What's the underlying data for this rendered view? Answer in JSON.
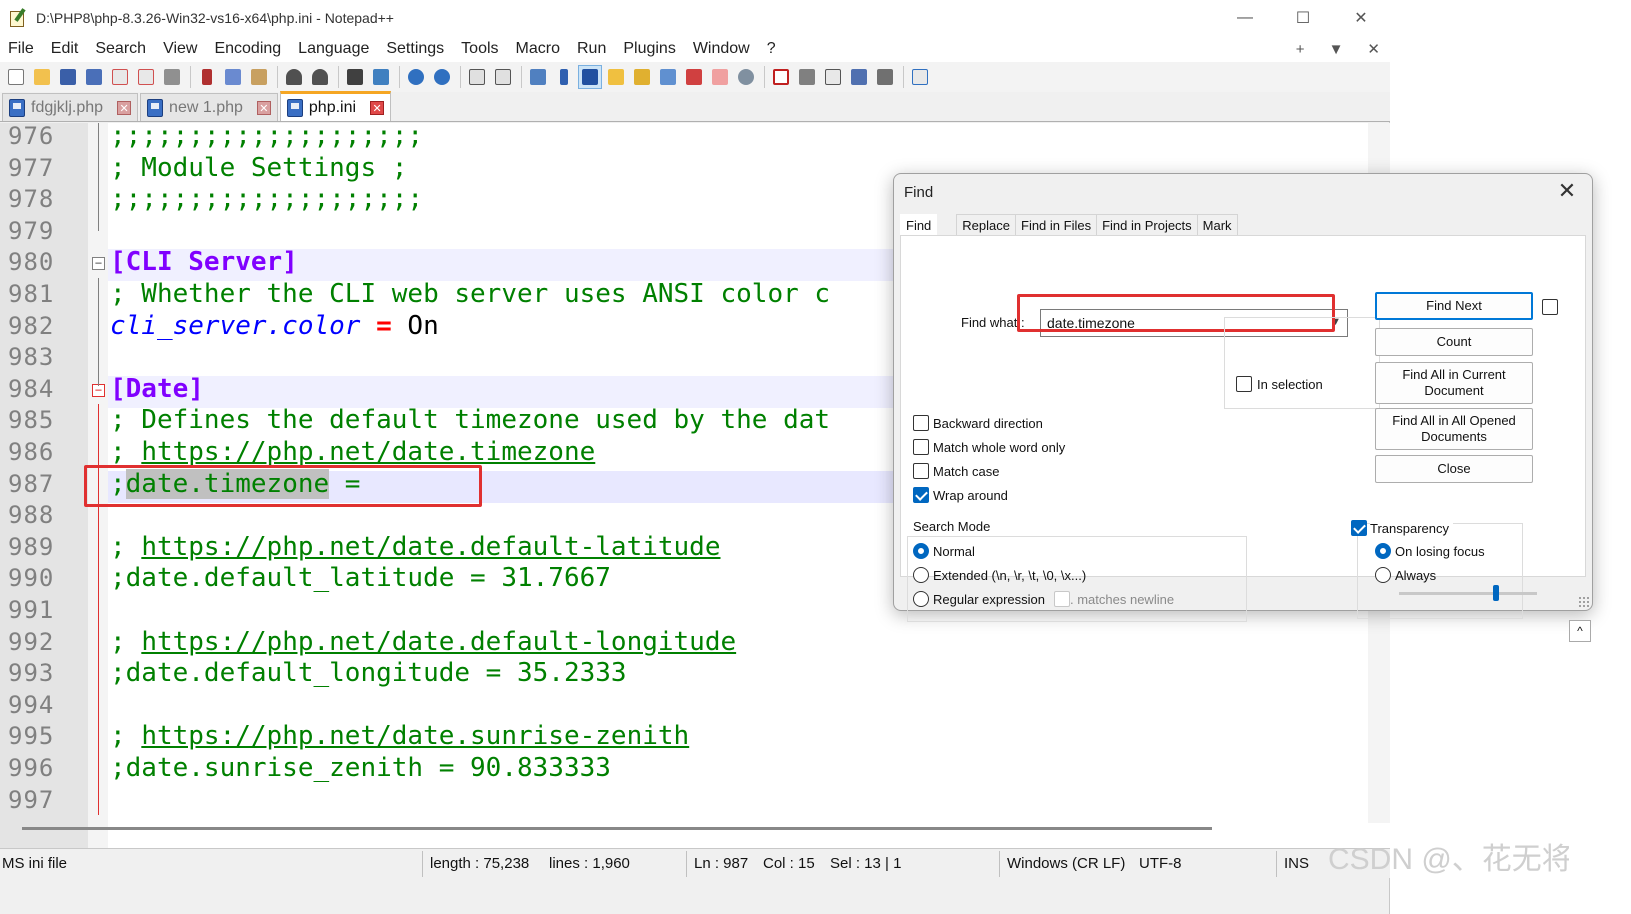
{
  "window": {
    "title": "D:\\PHP8\\php-8.3.26-Win32-vs16-x64\\php.ini - Notepad++",
    "controls": [
      "—",
      "☐",
      "✕"
    ]
  },
  "menu": [
    "File",
    "Edit",
    "Search",
    "View",
    "Encoding",
    "Language",
    "Settings",
    "Tools",
    "Macro",
    "Run",
    "Plugins",
    "Window",
    "?"
  ],
  "menu_right": [
    "+",
    "▼",
    "✕"
  ],
  "tabs": [
    {
      "label": "fdgjklj.php",
      "active": false
    },
    {
      "label": "new 1.php",
      "active": false
    },
    {
      "label": "php.ini",
      "active": true
    }
  ],
  "editor": {
    "lines": [
      {
        "num": "976",
        "parts": [
          {
            "t": ";;;;;;;;;;;;;;;;;;;;",
            "c": "c-green"
          }
        ]
      },
      {
        "num": "977",
        "parts": [
          {
            "t": "; Module Settings ;",
            "c": "c-green"
          }
        ]
      },
      {
        "num": "978",
        "parts": [
          {
            "t": ";;;;;;;;;;;;;;;;;;;;",
            "c": "c-green"
          }
        ]
      },
      {
        "num": "979",
        "parts": []
      },
      {
        "num": "980",
        "parts": [
          {
            "t": "[CLI Server]",
            "c": "c-section"
          }
        ]
      },
      {
        "num": "981",
        "parts": [
          {
            "t": "; Whether the CLI web server uses ANSI color c",
            "c": "c-green"
          }
        ]
      },
      {
        "num": "982",
        "parts": [
          {
            "t": "cli_server.color",
            "c": "c-key"
          },
          {
            "t": " = ",
            "c": "c-op"
          },
          {
            "t": "On",
            "c": "c-val"
          }
        ]
      },
      {
        "num": "983",
        "parts": []
      },
      {
        "num": "984",
        "parts": [
          {
            "t": "[Date]",
            "c": "c-section"
          }
        ]
      },
      {
        "num": "985",
        "parts": [
          {
            "t": "; Defines the default timezone used by the dat",
            "c": "c-green"
          }
        ]
      },
      {
        "num": "986",
        "parts": [
          {
            "t": "; ",
            "c": "c-green"
          },
          {
            "t": "https://php.net/date.timezone",
            "c": "c-link"
          }
        ]
      },
      {
        "num": "987",
        "parts": [
          {
            "t": ";",
            "c": "c-green"
          },
          {
            "t": "date.timezone",
            "c": "c-green sel-hl"
          },
          {
            "t": " =",
            "c": "c-green"
          }
        ]
      },
      {
        "num": "988",
        "parts": []
      },
      {
        "num": "989",
        "parts": [
          {
            "t": "; ",
            "c": "c-green"
          },
          {
            "t": "https://php.net/date.default-latitude",
            "c": "c-link"
          }
        ]
      },
      {
        "num": "990",
        "parts": [
          {
            "t": ";date.default_latitude = 31.7667",
            "c": "c-green"
          }
        ]
      },
      {
        "num": "991",
        "parts": []
      },
      {
        "num": "992",
        "parts": [
          {
            "t": "; ",
            "c": "c-green"
          },
          {
            "t": "https://php.net/date.default-longitude",
            "c": "c-link"
          }
        ]
      },
      {
        "num": "993",
        "parts": [
          {
            "t": ";date.default_longitude = 35.2333",
            "c": "c-green"
          }
        ]
      },
      {
        "num": "994",
        "parts": []
      },
      {
        "num": "995",
        "parts": [
          {
            "t": "; ",
            "c": "c-green"
          },
          {
            "t": "https://php.net/date.sunrise-zenith",
            "c": "c-link"
          }
        ]
      },
      {
        "num": "996",
        "parts": [
          {
            "t": ";date.sunrise_zenith = 90.833333",
            "c": "c-green"
          }
        ]
      },
      {
        "num": "997",
        "parts": []
      }
    ]
  },
  "status": {
    "filetype": "MS ini file",
    "length": "length : 75,238",
    "lines": "lines : 1,960",
    "ln": "Ln : 987",
    "col": "Col : 15",
    "sel": "Sel : 13 | 1",
    "eol": "Windows (CR LF)",
    "encoding": "UTF-8",
    "mode": "INS"
  },
  "find_dialog": {
    "title": "Find",
    "tabs": [
      "Find",
      "Replace",
      "Find in Files",
      "Find in Projects",
      "Mark"
    ],
    "find_what_label": "Find what :",
    "find_what_value": "date.timezone",
    "buttons": {
      "find_next": "Find Next",
      "count": "Count",
      "find_all_current": "Find All in Current Document",
      "find_all_opened": "Find All in All Opened Documents",
      "close": "Close"
    },
    "in_selection": "In selection",
    "options": [
      {
        "label": "Backward direction",
        "checked": false
      },
      {
        "label": "Match whole word only",
        "checked": false
      },
      {
        "label": "Match case",
        "checked": false
      },
      {
        "label": "Wrap around",
        "checked": true
      }
    ],
    "search_mode_label": "Search Mode",
    "modes": [
      {
        "label": "Normal",
        "selected": true
      },
      {
        "label": "Extended (\\n, \\r, \\t, \\0, \\x...)",
        "selected": false
      },
      {
        "label": "Regular expression",
        "selected": false
      }
    ],
    "matches_newline": ". matches newline",
    "transparency_label": "Transparency",
    "transparency_checked": true,
    "transparency_modes": [
      {
        "label": "On losing focus",
        "selected": true
      },
      {
        "label": "Always",
        "selected": false
      }
    ],
    "transparency_level": 0.7
  },
  "watermark": "CSDN @、花无将"
}
